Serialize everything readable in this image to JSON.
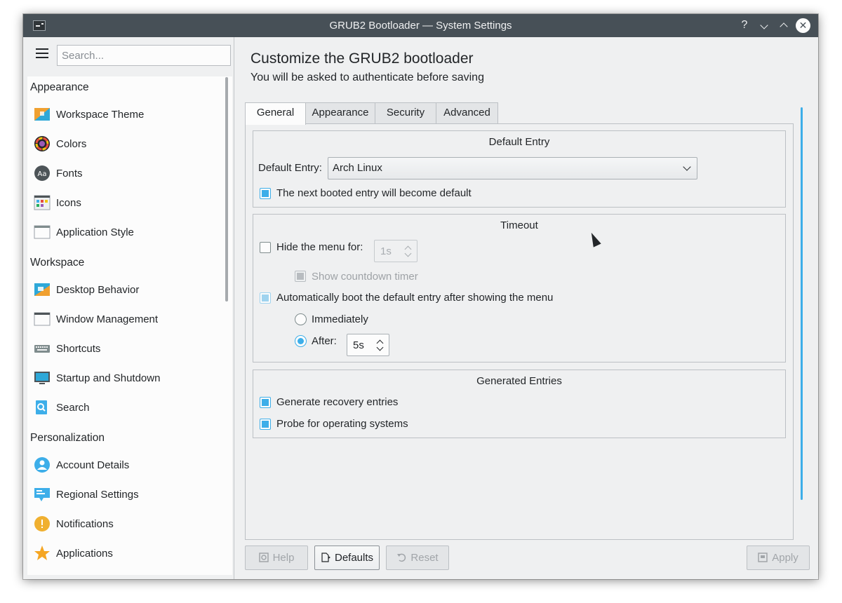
{
  "window": {
    "title": "GRUB2 Bootloader — System Settings",
    "controls": [
      "?",
      "⌄",
      "⌃",
      "✕"
    ]
  },
  "sidebar": {
    "search_placeholder": "Search...",
    "categories": [
      {
        "label": "Appearance",
        "items": [
          {
            "label": "Workspace Theme",
            "icon": "workspace-theme-icon"
          },
          {
            "label": "Colors",
            "icon": "colors-icon"
          },
          {
            "label": "Fonts",
            "icon": "fonts-icon"
          },
          {
            "label": "Icons",
            "icon": "icons-icon"
          },
          {
            "label": "Application Style",
            "icon": "application-style-icon"
          }
        ]
      },
      {
        "label": "Workspace",
        "items": [
          {
            "label": "Desktop Behavior",
            "icon": "desktop-behavior-icon"
          },
          {
            "label": "Window Management",
            "icon": "window-management-icon"
          },
          {
            "label": "Shortcuts",
            "icon": "keyboard-icon"
          },
          {
            "label": "Startup and Shutdown",
            "icon": "monitor-icon"
          },
          {
            "label": "Search",
            "icon": "search-icon"
          }
        ]
      },
      {
        "label": "Personalization",
        "items": [
          {
            "label": "Account Details",
            "icon": "user-icon"
          },
          {
            "label": "Regional Settings",
            "icon": "flag-icon"
          },
          {
            "label": "Notifications",
            "icon": "notification-icon"
          },
          {
            "label": "Applications",
            "icon": "star-icon"
          }
        ]
      }
    ]
  },
  "main": {
    "title": "Customize the GRUB2 bootloader",
    "subtitle": "You will be asked to authenticate before saving",
    "tabs": [
      "General",
      "Appearance",
      "Security",
      "Advanced"
    ],
    "active_tab": "General",
    "default_entry_group": {
      "title": "Default Entry",
      "label": "Default Entry:",
      "selected": "Arch Linux",
      "next_booted_label": "The next booted entry will become default",
      "next_booted_checked": true
    },
    "timeout_group": {
      "title": "Timeout",
      "hide_menu_label": "Hide the menu for:",
      "hide_menu_checked": false,
      "hide_menu_value": "1s",
      "show_countdown_label": "Show countdown timer",
      "show_countdown_checked": true,
      "auto_boot_label": "Automatically boot the default entry after showing the menu",
      "auto_boot_checked": true,
      "immediately_label": "Immediately",
      "after_label": "After:",
      "after_value": "5s",
      "after_selected": true
    },
    "generated_group": {
      "title": "Generated Entries",
      "recovery_label": "Generate recovery entries",
      "recovery_checked": true,
      "probe_label": "Probe for operating systems",
      "probe_checked": true
    }
  },
  "buttons": {
    "help": "Help",
    "defaults": "Defaults",
    "reset": "Reset",
    "apply": "Apply"
  },
  "colors": {
    "accent": "#3daee9",
    "titlebar": "#475057",
    "window_bg": "#eff0f1"
  }
}
